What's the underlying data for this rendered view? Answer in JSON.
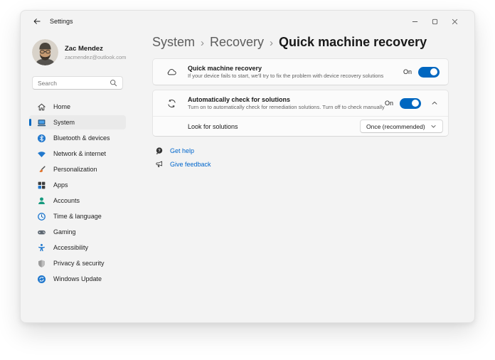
{
  "titlebar": {
    "title": "Settings",
    "controls": {
      "minimize": "minimize",
      "maximize": "maximize",
      "close": "close"
    }
  },
  "profile": {
    "name": "Zac Mendez",
    "email": "zacmendez@outlook.com"
  },
  "search": {
    "placeholder": "Search",
    "icon": "search-icon"
  },
  "sidebar": {
    "items": [
      {
        "label": "Home",
        "icon": "home-icon",
        "active": false
      },
      {
        "label": "System",
        "icon": "system-icon",
        "active": true
      },
      {
        "label": "Bluetooth & devices",
        "icon": "bluetooth-icon",
        "active": false
      },
      {
        "label": "Network & internet",
        "icon": "network-icon",
        "active": false
      },
      {
        "label": "Personalization",
        "icon": "personalization-icon",
        "active": false
      },
      {
        "label": "Apps",
        "icon": "apps-icon",
        "active": false
      },
      {
        "label": "Accounts",
        "icon": "accounts-icon",
        "active": false
      },
      {
        "label": "Time & language",
        "icon": "time-language-icon",
        "active": false
      },
      {
        "label": "Gaming",
        "icon": "gaming-icon",
        "active": false
      },
      {
        "label": "Accessibility",
        "icon": "accessibility-icon",
        "active": false
      },
      {
        "label": "Privacy & security",
        "icon": "privacy-icon",
        "active": false
      },
      {
        "label": "Windows Update",
        "icon": "windows-update-icon",
        "active": false
      }
    ]
  },
  "breadcrumb": {
    "segments": [
      "System",
      "Recovery",
      "Quick machine recovery"
    ],
    "separator": "›"
  },
  "settings": {
    "quick_machine_recovery": {
      "icon": "cloud-icon",
      "title": "Quick machine recovery",
      "description": "If your device fails to start, we'll try to fix the problem with device recovery solutions",
      "toggle_label": "On",
      "toggle_state": "on"
    },
    "auto_check": {
      "icon": "sync-icon",
      "title": "Automatically check for solutions",
      "description": "Turn on to automatically check for remediation solutions. Turn off to check manually.",
      "toggle_label": "On",
      "toggle_state": "on",
      "expanded": true
    },
    "look_for_solutions": {
      "label": "Look for solutions",
      "selected_option": "Once (recommended)"
    }
  },
  "links": [
    {
      "label": "Get help",
      "icon": "help-icon"
    },
    {
      "label": "Give feedback",
      "icon": "feedback-icon"
    }
  ],
  "colors": {
    "accent": "#0067C0",
    "link": "#0066CC",
    "window_bg": "#F3F3F3",
    "card_bg": "#FBFBFB",
    "card_border": "#E5E5E5",
    "selected_item_bg": "#EAEAEA"
  }
}
